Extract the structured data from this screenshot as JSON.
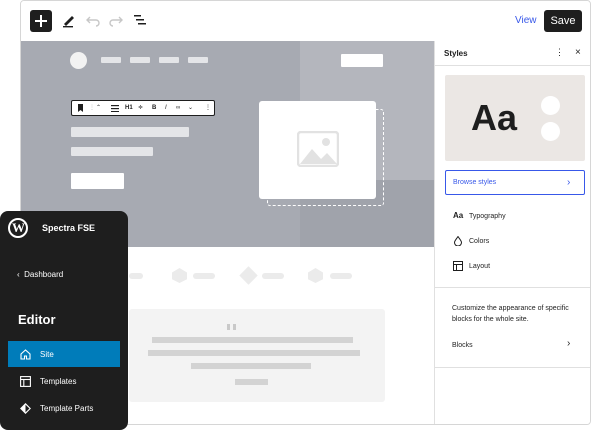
{
  "toolbar": {
    "view_label": "View",
    "save_label": "Save"
  },
  "block_toolbar": {
    "heading_level": "H1",
    "bold": "B",
    "italic": "I"
  },
  "sidebar": {
    "title": "Styles",
    "preview_text": "Aa",
    "browse_label": "Browse styles",
    "items": [
      {
        "label": "Typography",
        "icon": "typography-icon"
      },
      {
        "label": "Colors",
        "icon": "droplet-icon"
      },
      {
        "label": "Layout",
        "icon": "layout-icon"
      }
    ],
    "description": "Customize the appearance of specific blocks for the whole site.",
    "blocks_label": "Blocks"
  },
  "admin": {
    "site_name": "Spectra FSE",
    "back_label": "Dashboard",
    "section_title": "Editor",
    "nav": [
      {
        "label": "Site",
        "icon": "home-icon",
        "active": true
      },
      {
        "label": "Templates",
        "icon": "template-icon",
        "active": false
      },
      {
        "label": "Template Parts",
        "icon": "diamond-icon",
        "active": false
      }
    ]
  },
  "colors": {
    "accent": "#3858e9",
    "active_nav": "#007cba",
    "dark": "#1e1e1e"
  }
}
